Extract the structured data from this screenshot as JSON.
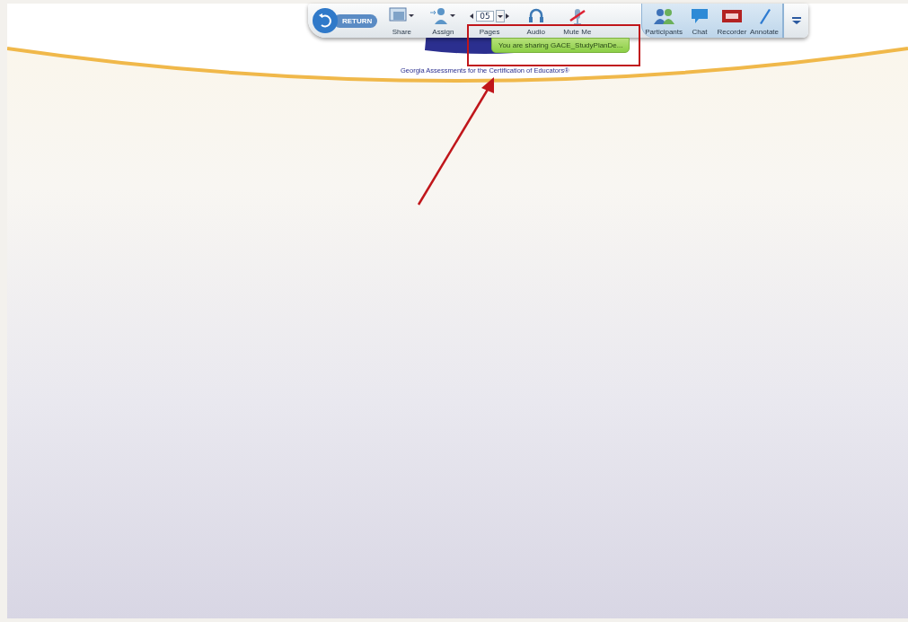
{
  "toolbar": {
    "return_label": "RETURN",
    "page_number": "05",
    "items": [
      {
        "label": "Share",
        "kind": "share"
      },
      {
        "label": "Assign",
        "kind": "assign"
      },
      {
        "label": "Pages",
        "kind": "pages"
      },
      {
        "label": "Audio",
        "kind": "audio"
      },
      {
        "label": "Mute Me",
        "kind": "mute"
      },
      {
        "label": "Participants",
        "kind": "participants"
      },
      {
        "label": "Chat",
        "kind": "chat"
      },
      {
        "label": "Recorder",
        "kind": "recorder"
      },
      {
        "label": "Annotate",
        "kind": "annotate"
      }
    ]
  },
  "tooltip": "You are sharing GACE_StudyPlanDe...",
  "logo": {
    "tagline": "Georgia Assessments for the Certification of Educators®"
  }
}
